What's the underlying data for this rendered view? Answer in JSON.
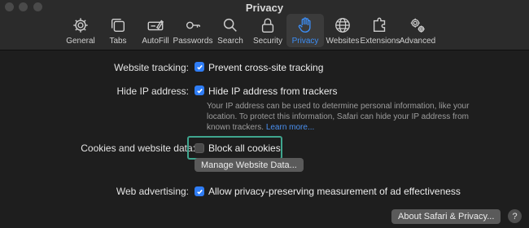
{
  "window": {
    "title": "Privacy"
  },
  "toolbar": {
    "items": [
      {
        "label": "General",
        "icon": "gear-icon",
        "active": false
      },
      {
        "label": "Tabs",
        "icon": "tabs-icon",
        "active": false
      },
      {
        "label": "AutoFill",
        "icon": "autofill-icon",
        "active": false
      },
      {
        "label": "Passwords",
        "icon": "key-icon",
        "active": false
      },
      {
        "label": "Search",
        "icon": "magnifier-icon",
        "active": false
      },
      {
        "label": "Security",
        "icon": "lock-icon",
        "active": false
      },
      {
        "label": "Privacy",
        "icon": "hand-icon",
        "active": true
      },
      {
        "label": "Websites",
        "icon": "globe-icon",
        "active": false
      },
      {
        "label": "Extensions",
        "icon": "extensions-icon",
        "active": false
      },
      {
        "label": "Advanced",
        "icon": "gears-icon",
        "active": false
      }
    ],
    "accent_color": "#3c8ef6"
  },
  "settings": {
    "website_tracking": {
      "label": "Website tracking:",
      "option": "Prevent cross-site tracking",
      "checked": true
    },
    "hide_ip": {
      "label": "Hide IP address:",
      "option": "Hide IP address from trackers",
      "checked": true
    },
    "hide_ip_note": {
      "text": "Your IP address can be used to determine personal information, like your location. To protect this information, Safari can hide your IP address from known trackers.",
      "link": "Learn more..."
    },
    "cookies": {
      "label": "Cookies and website data:",
      "option": "Block all cookies",
      "checked": false
    },
    "manage_button": "Manage Website Data...",
    "web_advertising": {
      "label": "Web advertising:",
      "option": "Allow privacy-preserving measurement of ad effectiveness",
      "checked": true
    }
  },
  "footer": {
    "about_button": "About Safari & Privacy...",
    "help_button": "?"
  },
  "colors": {
    "checkbox_on": "#2f7df6",
    "focus_ring": "#3fa58e",
    "link": "#4a90f0"
  }
}
